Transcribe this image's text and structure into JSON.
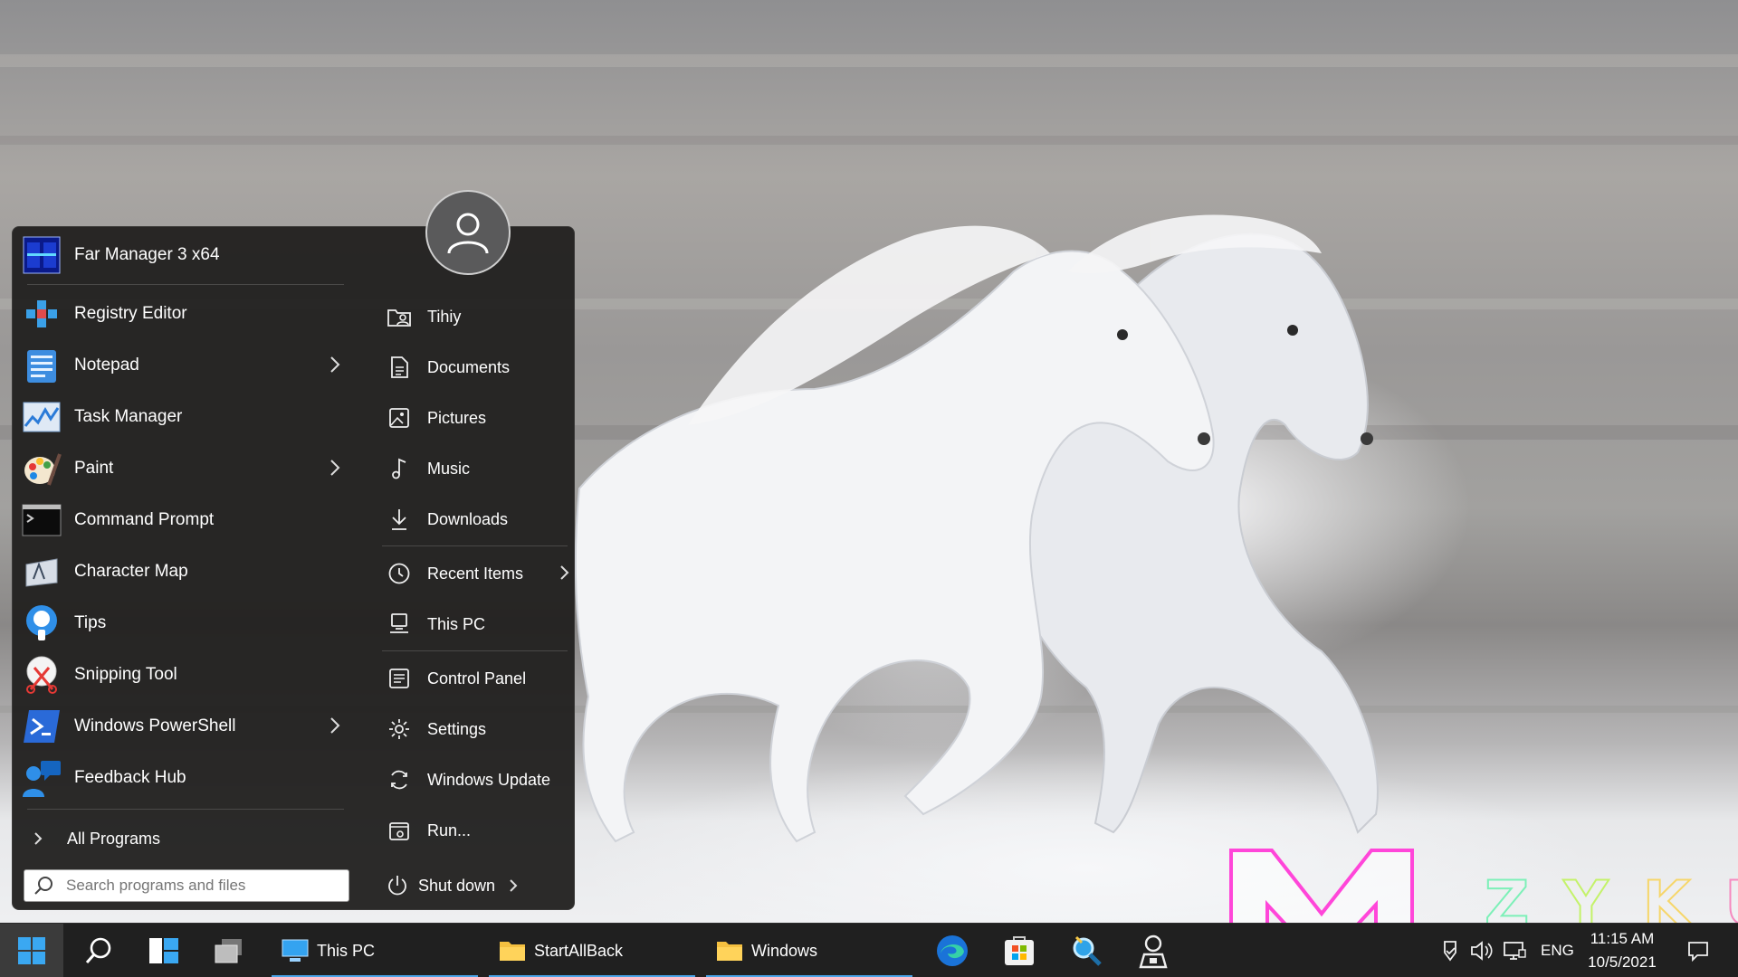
{
  "start_menu": {
    "pinned": [
      {
        "label": "Far Manager 3 x64",
        "icon": "far-manager-icon",
        "has_submenu": false
      },
      {
        "label": "Registry Editor",
        "icon": "registry-editor-icon",
        "has_submenu": false
      },
      {
        "label": "Notepad",
        "icon": "notepad-icon",
        "has_submenu": true
      },
      {
        "label": "Task Manager",
        "icon": "task-manager-icon",
        "has_submenu": false
      },
      {
        "label": "Paint",
        "icon": "paint-icon",
        "has_submenu": true
      },
      {
        "label": "Command Prompt",
        "icon": "command-prompt-icon",
        "has_submenu": false
      },
      {
        "label": "Character Map",
        "icon": "character-map-icon",
        "has_submenu": false
      },
      {
        "label": "Tips",
        "icon": "tips-icon",
        "has_submenu": false
      },
      {
        "label": "Snipping Tool",
        "icon": "snipping-tool-icon",
        "has_submenu": false
      },
      {
        "label": "Windows PowerShell",
        "icon": "powershell-icon",
        "has_submenu": true
      },
      {
        "label": "Feedback Hub",
        "icon": "feedback-hub-icon",
        "has_submenu": false
      }
    ],
    "all_programs_label": "All Programs",
    "search_placeholder": "Search programs and files",
    "places": [
      {
        "label": "Tihiy",
        "icon": "user-folder-icon"
      },
      {
        "label": "Documents",
        "icon": "documents-icon"
      },
      {
        "label": "Pictures",
        "icon": "pictures-icon"
      },
      {
        "label": "Music",
        "icon": "music-icon"
      },
      {
        "label": "Downloads",
        "icon": "downloads-icon"
      },
      {
        "label": "Recent Items",
        "icon": "recent-items-icon",
        "has_submenu": true
      },
      {
        "label": "This PC",
        "icon": "this-pc-icon"
      },
      {
        "label": "Control Panel",
        "icon": "control-panel-icon"
      },
      {
        "label": "Settings",
        "icon": "settings-icon"
      },
      {
        "label": "Windows Update",
        "icon": "windows-update-icon"
      },
      {
        "label": "Run...",
        "icon": "run-icon"
      }
    ],
    "shutdown_label": "Shut down"
  },
  "taskbar": {
    "windows": [
      {
        "label": "This PC",
        "icon": "this-pc-icon"
      },
      {
        "label": "StartAllBack",
        "icon": "folder-icon"
      },
      {
        "label": "Windows",
        "icon": "folder-icon"
      }
    ],
    "pinned_apps": [
      "edge-icon",
      "store-icon",
      "magnifier-app-icon",
      "agent-app-icon"
    ],
    "tray": {
      "language": "ENG",
      "time": "11:15 AM",
      "date": "10/5/2021"
    }
  },
  "watermark": {
    "letters": [
      "Z",
      "Y",
      "K",
      "U"
    ]
  },
  "colors": {
    "accent": "#4ba4e8",
    "menu_bg": "#222120",
    "taskbar_bg": "#202020"
  }
}
